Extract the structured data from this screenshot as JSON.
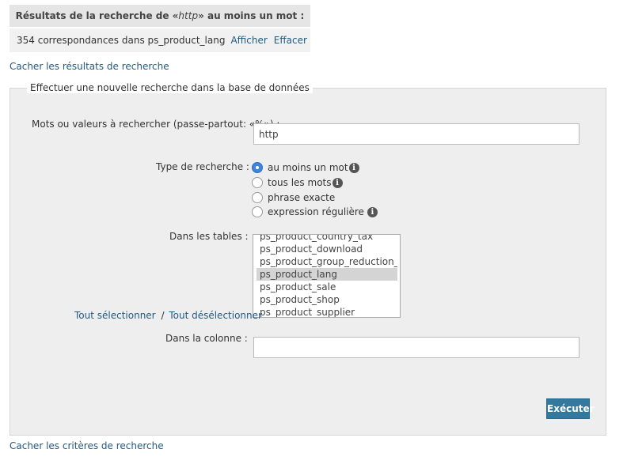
{
  "results": {
    "header_prefix": "Résultats de la recherche de «",
    "header_term": "http",
    "header_suffix": "» au moins un mot :",
    "match_text": "354 correspondances dans ps_product_lang",
    "show_link": "Afficher",
    "delete_link": "Effacer"
  },
  "hide_results_link": "Cacher les résultats de recherche",
  "search_form": {
    "legend": "Effectuer une nouvelle recherche dans la base de données",
    "words_label": "Mots ou valeurs à rechercher (passe-partout: «%») :",
    "words_value": "http",
    "search_type_label": "Type de recherche :",
    "search_types": [
      {
        "label": "au moins un mot",
        "selected": true,
        "has_info": true
      },
      {
        "label": "tous les mots",
        "selected": false,
        "has_info": true
      },
      {
        "label": "phrase exacte",
        "selected": false,
        "has_info": false
      },
      {
        "label": "expression régulière",
        "selected": false,
        "has_info": true
      }
    ],
    "info_icon": "info-circle-icon",
    "tables_label": "Dans les tables :",
    "tables": [
      {
        "name": "ps_product_country_tax",
        "selected": false
      },
      {
        "name": "ps_product_download",
        "selected": false
      },
      {
        "name": "ps_product_group_reduction_cache",
        "selected": false
      },
      {
        "name": "ps_product_lang",
        "selected": true
      },
      {
        "name": "ps_product_sale",
        "selected": false
      },
      {
        "name": "ps_product_shop",
        "selected": false
      },
      {
        "name": "ps_product_supplier",
        "selected": false
      }
    ],
    "select_all": "Tout sélectionner",
    "select_separator": "/",
    "deselect_all": "Tout désélectionner",
    "column_label": "Dans la colonne :",
    "column_value": "",
    "execute_button": "Exécuter"
  },
  "hide_criteria_link": "Cacher les critères de recherche",
  "colors": {
    "link": "#235a81",
    "button": "#33799e",
    "selected_radio": "#3d86db",
    "selected_option": "#d4d4d4"
  }
}
